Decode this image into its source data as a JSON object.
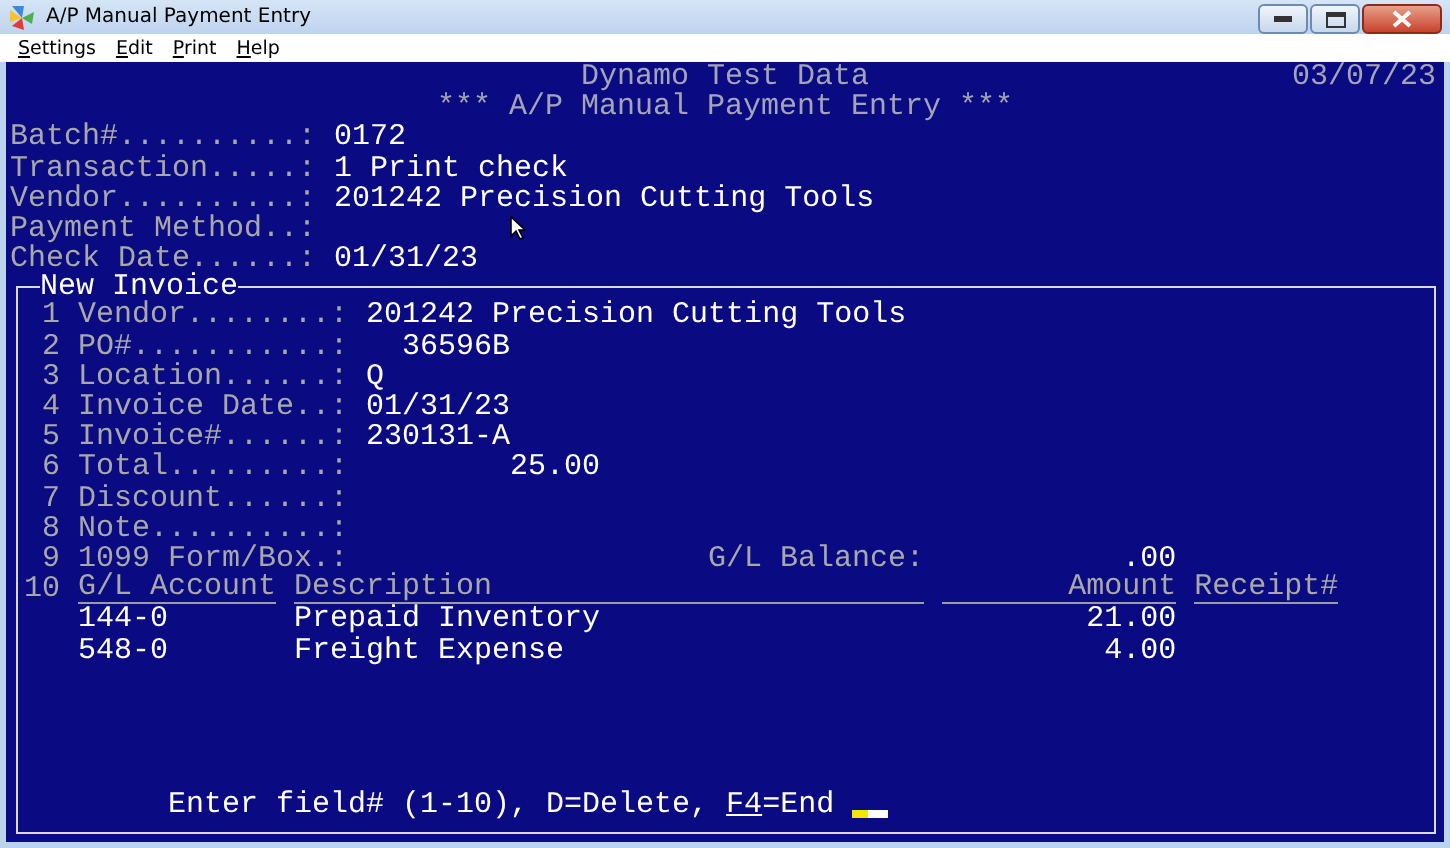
{
  "window": {
    "title": "A/P Manual Payment Entry"
  },
  "menu": [
    {
      "label": "Settings"
    },
    {
      "label": "Edit"
    },
    {
      "label": "Print"
    },
    {
      "label": "Help"
    }
  ],
  "header": {
    "company": "Dynamo Test Data",
    "date": "03/07/23",
    "title": "*** A/P Manual Payment Entry ***"
  },
  "fields": [
    {
      "label": "Batch#..........:",
      "value": "0172"
    },
    {
      "label": "Transaction.....:",
      "value": "1 Print check"
    },
    {
      "label": "Vendor..........:",
      "value": "201242 Precision Cutting Tools"
    },
    {
      "label": "Payment Method..:"
    },
    {
      "label": "Check Date......:",
      "value": "01/31/23"
    }
  ],
  "invoice": {
    "title": "New Invoice",
    "fields": [
      {
        "number": "1",
        "label": "Vendor........:",
        "value": "201242 Precision Cutting Tools",
        "kind": "text"
      },
      {
        "number": "2",
        "label": "PO#...........:",
        "value": "36596B",
        "kind": "code"
      },
      {
        "number": "3",
        "label": "Location......:",
        "value": "Q",
        "kind": "text"
      },
      {
        "number": "4",
        "label": "Invoice Date..:",
        "value": "01/31/23",
        "kind": "text"
      },
      {
        "number": "5",
        "label": "Invoice#......:",
        "value": "230131-A",
        "kind": "text"
      },
      {
        "number": "6",
        "label": "Total.........:",
        "value": "25.00",
        "kind": "amount"
      },
      {
        "number": "7",
        "label": "Discount......:"
      },
      {
        "number": "8",
        "label": "Note..........:"
      },
      {
        "number": "9",
        "label": "1099 Form/Box.:",
        "aside": {
          "label": "G/L Balance:",
          "value": ".00"
        }
      }
    ],
    "columns": {
      "number": "10",
      "account": "G/L Account",
      "description": "Description",
      "amount": "Amount",
      "receipt": "Receipt#"
    },
    "lines": [
      {
        "account": "144-0",
        "description": "Prepaid Inventory",
        "amount": "21.00"
      },
      {
        "account": "548-0",
        "description": "Freight Expense",
        "amount": "4.00"
      }
    ],
    "prompt": {
      "before": "Enter field# (1-10), D=Delete, ",
      "key": "F4",
      "after": "=End"
    }
  }
}
